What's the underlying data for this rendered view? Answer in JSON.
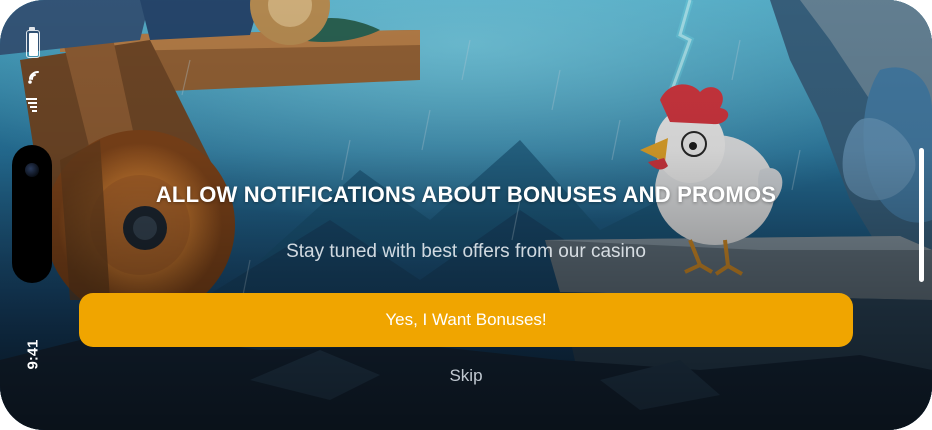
{
  "status_bar": {
    "time": "9:41"
  },
  "prompt": {
    "title": "ALLOW NOTIFICATIONS ABOUT BONUSES AND PROMOS",
    "subtitle": "Stay tuned with best offers from our casino",
    "primary_button_label": "Yes, I Want Bonuses!",
    "skip_label": "Skip"
  },
  "colors": {
    "accent": "#F0A500",
    "title_text": "#FFFFFF"
  },
  "icons": {
    "battery": "battery-icon",
    "wifi": "wifi-icon",
    "signal": "cellular-signal-icon"
  }
}
